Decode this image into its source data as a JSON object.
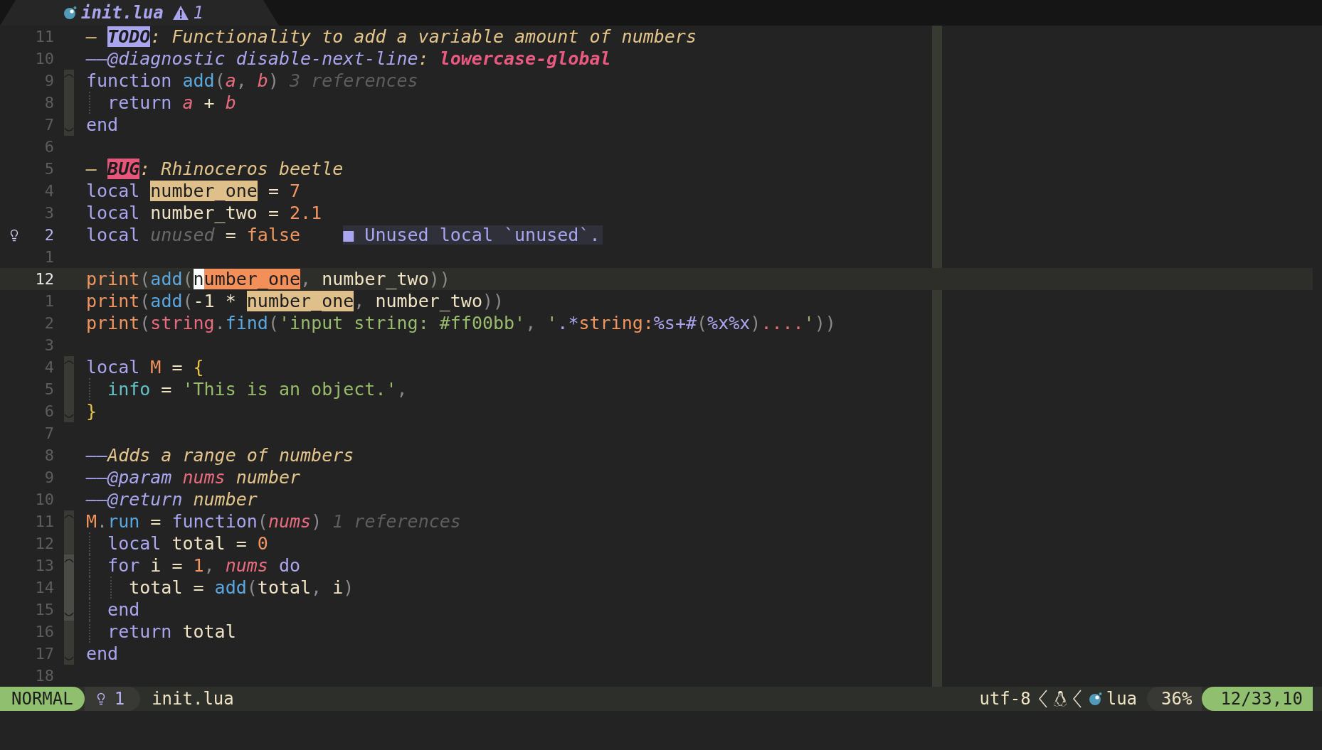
{
  "tab": {
    "title": "init.lua",
    "warnings": "1"
  },
  "lines": [
    {
      "number": "11",
      "current": false,
      "tokens": [
        {
          "text": "— ",
          "kind": "comment"
        },
        {
          "text": "TODO",
          "kind": "todo-tag"
        },
        {
          "text": ": Functionality to add a variable amount of numbers",
          "kind": "comment"
        }
      ]
    },
    {
      "number": "10",
      "current": false,
      "tokens": [
        {
          "text": "——@diagnostic disable-next-line",
          "kind": "annotation"
        },
        {
          "text": ": ",
          "kind": "comment"
        },
        {
          "text": "lowercase-global",
          "kind": "annotation-value"
        }
      ]
    },
    {
      "number": "9",
      "current": false,
      "fold": {
        "kind": "open"
      },
      "tokens": [
        {
          "text": "function ",
          "kind": "keyword"
        },
        {
          "text": "add",
          "kind": "function"
        },
        {
          "text": "(",
          "kind": "punct"
        },
        {
          "text": "a",
          "kind": "param"
        },
        {
          "text": ", ",
          "kind": "punct"
        },
        {
          "text": "b",
          "kind": "param"
        },
        {
          "text": ")",
          "kind": "punct"
        }
      ],
      "hint": "3 references"
    },
    {
      "number": "8",
      "current": false,
      "fold": {
        "kind": "inside"
      },
      "guides": [
        {
          "kind": "guide"
        }
      ],
      "tokens": [
        {
          "text": "return ",
          "kind": "keyword"
        },
        {
          "text": "a",
          "kind": "param"
        },
        {
          "text": " + ",
          "kind": "ident"
        },
        {
          "text": "b",
          "kind": "param"
        }
      ]
    },
    {
      "number": "7",
      "current": false,
      "fold": {
        "kind": "close"
      },
      "tokens": [
        {
          "text": "end",
          "kind": "keyword"
        }
      ]
    },
    {
      "number": "6",
      "current": false
    },
    {
      "number": "5",
      "current": false,
      "tokens": [
        {
          "text": "— ",
          "kind": "comment"
        },
        {
          "text": "BUG",
          "kind": "bug-tag"
        },
        {
          "text": ": Rhinoceros beetle",
          "kind": "comment"
        }
      ]
    },
    {
      "number": "4",
      "current": false,
      "tokens": [
        {
          "text": "local ",
          "kind": "keyword"
        },
        {
          "text": "number_one",
          "kind": "ref-highlight"
        },
        {
          "text": " = ",
          "kind": "ident"
        },
        {
          "text": "7",
          "kind": "number"
        }
      ]
    },
    {
      "number": "3",
      "current": false,
      "tokens": [
        {
          "text": "local",
          "kind": "keyword"
        },
        {
          "text": " number_two = ",
          "kind": "ident"
        },
        {
          "text": "2.1",
          "kind": "number"
        }
      ]
    },
    {
      "number": "2",
      "current": false,
      "hint_sign": true,
      "tokens": [
        {
          "text": "local ",
          "kind": "keyword"
        },
        {
          "text": "unused",
          "kind": "unused"
        },
        {
          "text": " = ",
          "kind": "ident"
        },
        {
          "text": "false",
          "kind": "number"
        }
      ],
      "diagnostic": "■ Unused local `unused`."
    },
    {
      "number": "1",
      "current": false
    },
    {
      "number": "12",
      "current": true,
      "tokens": [
        {
          "text": "print",
          "kind": "builtin"
        },
        {
          "text": "(",
          "kind": "punct"
        },
        {
          "text": "add",
          "kind": "function"
        },
        {
          "text": "(",
          "kind": "punct"
        },
        {
          "text": "n",
          "kind": "cursor"
        },
        {
          "text": "umber_one",
          "kind": "current-highlight"
        },
        {
          "text": ", ",
          "kind": "punct"
        },
        {
          "text": "number_two",
          "kind": "ident"
        },
        {
          "text": "))",
          "kind": "punct"
        }
      ]
    },
    {
      "number": "1",
      "current": false,
      "tokens": [
        {
          "text": "print",
          "kind": "builtin"
        },
        {
          "text": "(",
          "kind": "punct"
        },
        {
          "text": "add",
          "kind": "function"
        },
        {
          "text": "(",
          "kind": "punct"
        },
        {
          "text": "-1 * ",
          "kind": "ident"
        },
        {
          "text": "number_one",
          "kind": "ref-highlight"
        },
        {
          "text": ", ",
          "kind": "punct"
        },
        {
          "text": "number_two",
          "kind": "ident"
        },
        {
          "text": "))",
          "kind": "punct"
        }
      ]
    },
    {
      "number": "2",
      "current": false,
      "tokens": [
        {
          "text": "print",
          "kind": "builtin"
        },
        {
          "text": "(",
          "kind": "punct"
        },
        {
          "text": "string",
          "kind": "module"
        },
        {
          "text": ".",
          "kind": "punct"
        },
        {
          "text": "find",
          "kind": "function"
        },
        {
          "text": "(",
          "kind": "punct"
        },
        {
          "text": "'input string: #ff00bb'",
          "kind": "string"
        },
        {
          "text": ", ",
          "kind": "punct"
        },
        {
          "text": "'",
          "kind": "string"
        },
        {
          "text": ".*",
          "kind": "regex"
        },
        {
          "text": "string:",
          "kind": "builtin"
        },
        {
          "text": "%s+#",
          "kind": "regex"
        },
        {
          "text": "(",
          "kind": "punct"
        },
        {
          "text": "%x%x",
          "kind": "regex"
        },
        {
          "text": ")",
          "kind": "punct"
        },
        {
          "text": "....",
          "kind": "module"
        },
        {
          "text": "'",
          "kind": "string"
        },
        {
          "text": "))",
          "kind": "punct"
        }
      ]
    },
    {
      "number": "3",
      "current": false
    },
    {
      "number": "4",
      "current": false,
      "fold": {
        "kind": "open"
      },
      "tokens": [
        {
          "text": "local ",
          "kind": "keyword"
        },
        {
          "text": "M",
          "kind": "builtin"
        },
        {
          "text": " = ",
          "kind": "ident"
        },
        {
          "text": "{",
          "kind": "bracket"
        }
      ]
    },
    {
      "number": "5",
      "current": false,
      "fold": {
        "kind": "inside"
      },
      "guides": [
        {
          "kind": "guide"
        }
      ],
      "tokens": [
        {
          "text": "info",
          "kind": "field"
        },
        {
          "text": " = ",
          "kind": "ident"
        },
        {
          "text": "'This is an object.'",
          "kind": "string"
        },
        {
          "text": ",",
          "kind": "punct"
        }
      ]
    },
    {
      "number": "6",
      "current": false,
      "fold": {
        "kind": "close"
      },
      "tokens": [
        {
          "text": "}",
          "kind": "bracket"
        }
      ]
    },
    {
      "number": "7",
      "current": false
    },
    {
      "number": "8",
      "current": false,
      "tokens": [
        {
          "text": "——",
          "kind": "annotation"
        },
        {
          "text": "Adds a range of numbers",
          "kind": "comment"
        }
      ]
    },
    {
      "number": "9",
      "current": false,
      "tokens": [
        {
          "text": "——@param ",
          "kind": "annotation"
        },
        {
          "text": "nums",
          "kind": "param"
        },
        {
          "text": " number",
          "kind": "type"
        }
      ]
    },
    {
      "number": "10",
      "current": false,
      "tokens": [
        {
          "text": "——@return ",
          "kind": "annotation"
        },
        {
          "text": "number",
          "kind": "type"
        }
      ]
    },
    {
      "number": "11",
      "current": false,
      "fold": {
        "kind": "open"
      },
      "tokens": [
        {
          "text": "M",
          "kind": "builtin"
        },
        {
          "text": ".",
          "kind": "punct"
        },
        {
          "text": "run",
          "kind": "function"
        },
        {
          "text": " = ",
          "kind": "ident"
        },
        {
          "text": "function",
          "kind": "keyword"
        },
        {
          "text": "(",
          "kind": "punct"
        },
        {
          "text": "nums",
          "kind": "param"
        },
        {
          "text": ")",
          "kind": "punct"
        }
      ],
      "hint": "1 references"
    },
    {
      "number": "12",
      "current": false,
      "fold": {
        "kind": "inside"
      },
      "guides": [
        {
          "kind": "guide"
        }
      ],
      "tokens": [
        {
          "text": "local",
          "kind": "keyword"
        },
        {
          "text": " total = ",
          "kind": "ident"
        },
        {
          "text": "0",
          "kind": "number"
        }
      ]
    },
    {
      "number": "13",
      "current": false,
      "fold": {
        "kind": "inner-open"
      },
      "guides": [
        {
          "kind": "guide"
        }
      ],
      "tokens": [
        {
          "text": "for",
          "kind": "keyword"
        },
        {
          "text": " i = ",
          "kind": "ident"
        },
        {
          "text": "1",
          "kind": "number"
        },
        {
          "text": ", ",
          "kind": "punct"
        },
        {
          "text": "nums",
          "kind": "param"
        },
        {
          "text": " do",
          "kind": "keyword"
        }
      ]
    },
    {
      "number": "14",
      "current": false,
      "fold": {
        "kind": "inner-inside"
      },
      "guides": [
        {
          "kind": "guide"
        },
        {
          "kind": "guide"
        }
      ],
      "tokens": [
        {
          "text": "total = ",
          "kind": "ident"
        },
        {
          "text": "add",
          "kind": "function"
        },
        {
          "text": "(",
          "kind": "punct"
        },
        {
          "text": "total",
          "kind": "ident"
        },
        {
          "text": ", ",
          "kind": "punct"
        },
        {
          "text": "i",
          "kind": "ident"
        },
        {
          "text": ")",
          "kind": "punct"
        }
      ]
    },
    {
      "number": "15",
      "current": false,
      "fold": {
        "kind": "inner-close"
      },
      "guides": [
        {
          "kind": "guide"
        }
      ],
      "tokens": [
        {
          "text": "end",
          "kind": "keyword"
        }
      ]
    },
    {
      "number": "16",
      "current": false,
      "fold": {
        "kind": "inside"
      },
      "guides": [
        {
          "kind": "guide"
        }
      ],
      "tokens": [
        {
          "text": "return",
          "kind": "keyword"
        },
        {
          "text": " total",
          "kind": "ident"
        }
      ]
    },
    {
      "number": "17",
      "current": false,
      "fold": {
        "kind": "close"
      },
      "tokens": [
        {
          "text": "end",
          "kind": "keyword"
        }
      ]
    },
    {
      "number": "18",
      "current": false
    }
  ],
  "status_bar": {
    "mode": "NORMAL",
    "hints": "1",
    "file": "init.lua",
    "encoding": "utf-8",
    "filetype": "lua",
    "progress": "36%",
    "position": "12/33,10"
  }
}
